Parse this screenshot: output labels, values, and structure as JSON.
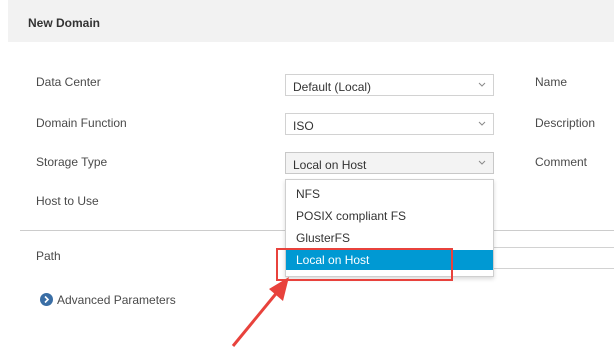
{
  "dialog": {
    "title": "New Domain"
  },
  "form": {
    "data_center": {
      "label": "Data Center",
      "value": "Default (Local)"
    },
    "domain_function": {
      "label": "Domain Function",
      "value": "ISO"
    },
    "storage_type": {
      "label": "Storage Type",
      "value": "Local on Host"
    },
    "host_to_use": {
      "label": "Host to Use"
    },
    "path": {
      "label": "Path",
      "value": ""
    },
    "right_labels": {
      "name": "Name",
      "description": "Description",
      "comment": "Comment"
    }
  },
  "dropdown": {
    "options": [
      "NFS",
      "POSIX compliant FS",
      "GlusterFS",
      "Local on Host"
    ],
    "selected": "Local on Host"
  },
  "advanced": {
    "label": "Advanced Parameters",
    "icon": "chevron-right-circle-icon"
  },
  "colors": {
    "selected_bg": "#0099d3",
    "highlight_border": "#e8423c",
    "arrow": "#e8423c"
  }
}
